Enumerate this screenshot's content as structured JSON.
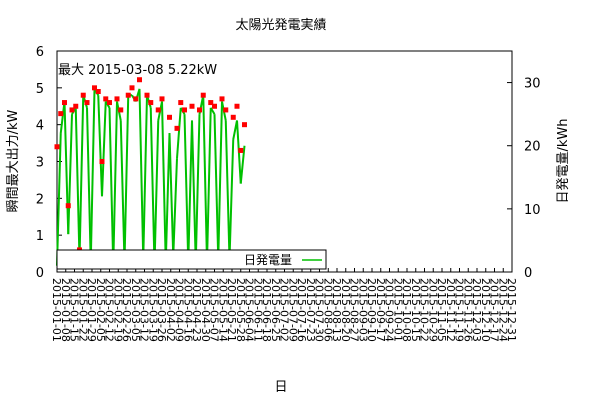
{
  "chart_data": {
    "type": "line",
    "title": "太陽光発電実績",
    "xlabel": "日",
    "ylabel_left": "瞬間最大出力/kW",
    "ylabel_right": "日発電量/kWh",
    "y_left_ticks": [
      "0",
      "1",
      "2",
      "3",
      "4",
      "5",
      "6"
    ],
    "y_left_lim": [
      0,
      6
    ],
    "y_right_ticks": [
      "0",
      "10",
      "20",
      "30"
    ],
    "y_right_lim": [
      0,
      35
    ],
    "annotation": "最大 2015-03-08 5.22kW",
    "legend_label": "日発電量",
    "legend_position": "bottom-center",
    "grid": false,
    "x_date_range": [
      "2015-01-01",
      "2015-12-31"
    ],
    "x_tick_labels": [
      "2015-01-01",
      "2015-01-08",
      "2015-01-15",
      "2015-01-22",
      "2015-01-29",
      "2015-02-05",
      "2015-02-12",
      "2015-02-19",
      "2015-02-26",
      "2015-03-05",
      "2015-03-12",
      "2015-03-19",
      "2015-03-26",
      "2015-04-02",
      "2015-04-09",
      "2015-04-16",
      "2015-04-23",
      "2015-04-30",
      "2015-05-07",
      "2015-05-14",
      "2015-05-21",
      "2015-05-28",
      "2015-06-04",
      "2015-06-11",
      "2015-06-18",
      "2015-06-25",
      "2015-07-02",
      "2015-07-09",
      "2015-07-16",
      "2015-07-23",
      "2015-07-30",
      "2015-08-06",
      "2015-08-13",
      "2015-08-20",
      "2015-08-27",
      "2015-09-03",
      "2015-09-10",
      "2015-09-17",
      "2015-09-24",
      "2015-10-01",
      "2015-10-08",
      "2015-10-15",
      "2015-10-22",
      "2015-10-29",
      "2015-11-05",
      "2015-11-12",
      "2015-11-19",
      "2015-11-26",
      "2015-12-03",
      "2015-12-10",
      "2015-12-17",
      "2015-12-24",
      "2015-12-31"
    ],
    "series": [
      {
        "name": "瞬間最大出力",
        "axis": "left",
        "color": "#ff0000",
        "style": "points",
        "x": [
          "2015-01-01",
          "2015-01-04",
          "2015-01-07",
          "2015-01-10",
          "2015-01-13",
          "2015-01-16",
          "2015-01-19",
          "2015-01-22",
          "2015-01-25",
          "2015-01-28",
          "2015-01-31",
          "2015-02-03",
          "2015-02-06",
          "2015-02-09",
          "2015-02-12",
          "2015-02-15",
          "2015-02-18",
          "2015-02-21",
          "2015-02-24",
          "2015-02-27",
          "2015-03-02",
          "2015-03-05",
          "2015-03-08",
          "2015-03-11",
          "2015-03-14",
          "2015-03-17",
          "2015-03-20",
          "2015-03-23",
          "2015-03-26",
          "2015-03-29",
          "2015-04-01",
          "2015-04-04",
          "2015-04-07",
          "2015-04-10",
          "2015-04-13",
          "2015-04-16",
          "2015-04-19",
          "2015-04-22",
          "2015-04-25",
          "2015-04-28",
          "2015-05-01",
          "2015-05-04",
          "2015-05-07",
          "2015-05-10",
          "2015-05-13",
          "2015-05-16",
          "2015-05-19",
          "2015-05-22",
          "2015-05-25",
          "2015-05-28",
          "2015-05-31"
        ],
        "values": [
          3.4,
          4.3,
          4.6,
          1.8,
          4.4,
          4.5,
          0.6,
          4.8,
          4.6,
          0.4,
          5.0,
          4.9,
          3.0,
          4.7,
          4.6,
          0.2,
          4.7,
          4.4,
          0.3,
          4.8,
          5.0,
          4.7,
          5.22,
          0.4,
          4.8,
          4.6,
          0.2,
          4.4,
          4.7,
          0.3,
          4.2,
          0.5,
          3.9,
          4.6,
          4.4,
          0.3,
          4.5,
          0.3,
          4.4,
          4.8,
          0.3,
          4.6,
          4.5,
          0.4,
          4.7,
          4.4,
          0.4,
          4.2,
          4.5,
          3.3,
          4.0
        ]
      },
      {
        "name": "日発電量",
        "axis": "right",
        "color": "#00c000",
        "style": "line",
        "x": [
          "2015-01-01",
          "2015-01-04",
          "2015-01-07",
          "2015-01-10",
          "2015-01-13",
          "2015-01-16",
          "2015-01-19",
          "2015-01-22",
          "2015-01-25",
          "2015-01-28",
          "2015-01-31",
          "2015-02-03",
          "2015-02-06",
          "2015-02-09",
          "2015-02-12",
          "2015-02-15",
          "2015-02-18",
          "2015-02-21",
          "2015-02-24",
          "2015-02-27",
          "2015-03-02",
          "2015-03-05",
          "2015-03-08",
          "2015-03-11",
          "2015-03-14",
          "2015-03-17",
          "2015-03-20",
          "2015-03-23",
          "2015-03-26",
          "2015-03-29",
          "2015-04-01",
          "2015-04-04",
          "2015-04-07",
          "2015-04-10",
          "2015-04-13",
          "2015-04-16",
          "2015-04-19",
          "2015-04-22",
          "2015-04-25",
          "2015-04-28",
          "2015-05-01",
          "2015-05-04",
          "2015-05-07",
          "2015-05-10",
          "2015-05-13",
          "2015-05-16",
          "2015-05-19",
          "2015-05-22",
          "2015-05-25",
          "2015-05-28",
          "2015-05-31"
        ],
        "values": [
          1.0,
          22.0,
          27.0,
          6.0,
          25.0,
          26.0,
          2.0,
          28.0,
          26.0,
          1.5,
          29.0,
          28.0,
          12.0,
          27.0,
          26.0,
          1.0,
          27.0,
          24.0,
          1.5,
          28.0,
          28.0,
          27.0,
          29.0,
          2.0,
          28.0,
          26.0,
          1.0,
          24.0,
          27.0,
          1.5,
          22.0,
          2.5,
          18.0,
          26.0,
          25.0,
          1.5,
          24.0,
          1.5,
          25.0,
          28.0,
          1.5,
          26.0,
          25.0,
          2.0,
          27.0,
          24.0,
          2.0,
          21.0,
          24.0,
          14.0,
          20.0
        ]
      }
    ]
  }
}
